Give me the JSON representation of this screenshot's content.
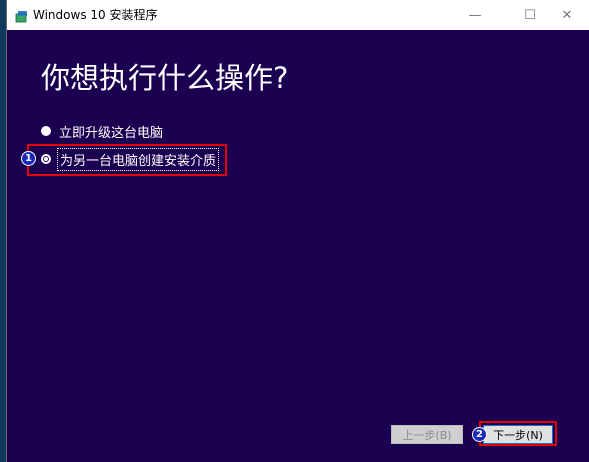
{
  "window": {
    "title": "Windows 10 安装程序",
    "minimize_glyph": "—",
    "maximize_glyph": "☐",
    "close_glyph": "✕"
  },
  "page": {
    "heading": "你想执行什么操作?"
  },
  "options": [
    {
      "label": "立即升级这台电脑",
      "selected": false
    },
    {
      "label": "为另一台电脑创建安装介质",
      "selected": true
    }
  ],
  "annotations": {
    "step1": "1",
    "step2": "2"
  },
  "buttons": {
    "back_label": "上一步(B)",
    "next_label": "下一步(N)"
  },
  "colors": {
    "background": "#1b0052",
    "highlight": "#e60000",
    "badge": "#1a2ab8"
  }
}
